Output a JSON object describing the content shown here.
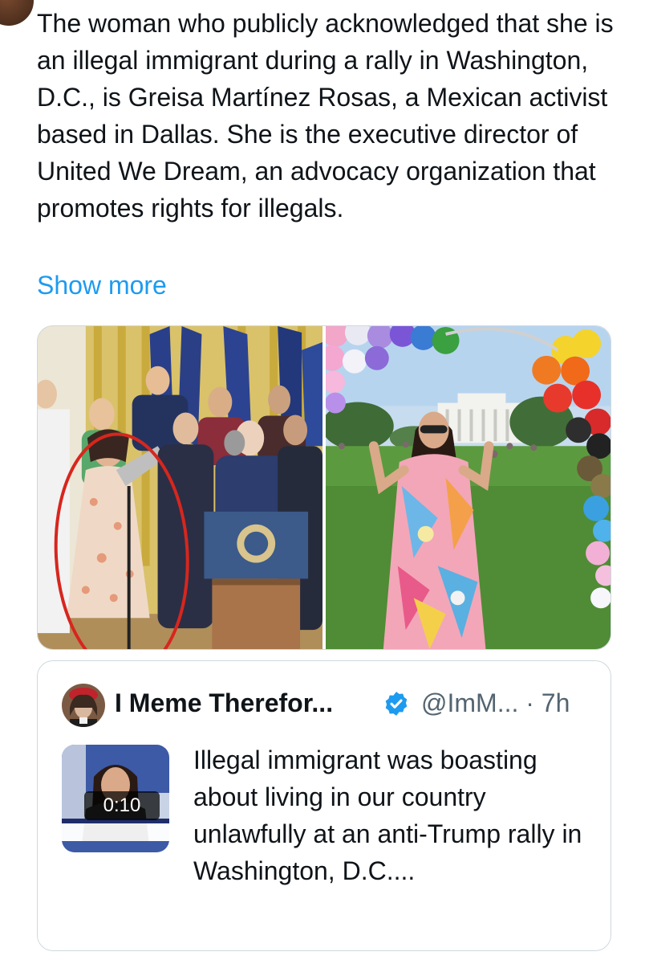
{
  "tweet": {
    "text": "The woman who publicly acknowledged that she is an illegal immigrant during a rally in Washington, D.C., is Greisa Martínez Rosas, a Mexican activist based in Dallas. She is the executive director of United We Dream, an advocacy organization that promotes rights for illegals.",
    "show_more": "Show more"
  },
  "media": {
    "left_photo_icon": "photo-press-event",
    "right_photo_icon": "photo-garden-balloons"
  },
  "quoted": {
    "name": "I Meme Therefor...",
    "handle": "@ImM...",
    "separator": "·",
    "time": "7h",
    "handle_line": "@ImM... · 7h",
    "text": "Illegal immigrant was boasting about living in our country unlawfully at an anti-Trump rally in Washington, D.C....",
    "video_duration": "0:10",
    "verified_icon": "verified-badge-icon"
  },
  "colors": {
    "link": "#1d9bf0",
    "text": "#0f1419",
    "secondary": "#536471",
    "border": "#cfd9de",
    "verified": "#1d9bf0",
    "highlight_circle": "#d7261e"
  }
}
